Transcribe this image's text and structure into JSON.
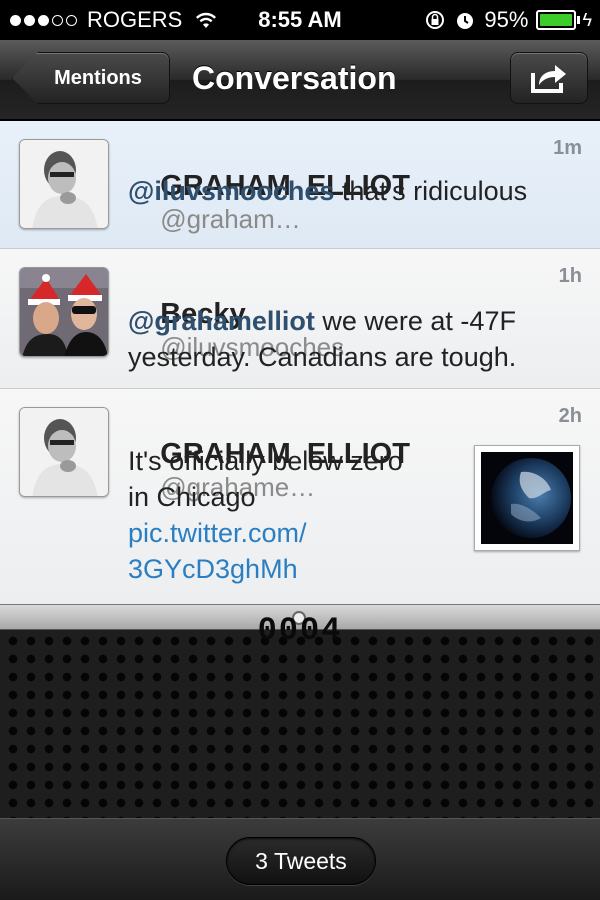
{
  "status_bar": {
    "carrier": "ROGERS",
    "time": "8:55 AM",
    "battery": "95%",
    "battery_color": "#3ccd2b",
    "signal_bars_filled": 3,
    "signal_bars_total": 5
  },
  "nav": {
    "back_label": "Mentions",
    "title": "Conversation",
    "share_icon": "share-icon"
  },
  "tweets": [
    {
      "name": "GRAHAM  ELLIOT",
      "handle": "@graham…",
      "time": "1m",
      "mention": "@iluvsmooches",
      "text": " that's ridiculous"
    },
    {
      "name": "Becky",
      "handle": "@iluvsmooches",
      "time": "1h",
      "mention": "@grahamelliot",
      "text_line1": " we were at -47F",
      "text_line2": "yesterday. Canadians are tough."
    },
    {
      "name": "GRAHAM  ELLIOT",
      "handle": "@grahame…",
      "time": "2h",
      "text_line1": "It's officially below zero",
      "text_line2": "in Chicago",
      "link_line1": "pic.twitter.com/",
      "link_line2": "3GYcD3ghMh"
    }
  ],
  "counter": "0004",
  "toolbar": {
    "tweet_count": "3 Tweets"
  },
  "colors": {
    "link": "#2a7ec3",
    "mention": "#2f4f6f",
    "selected_bg": "#e8f1fa"
  }
}
